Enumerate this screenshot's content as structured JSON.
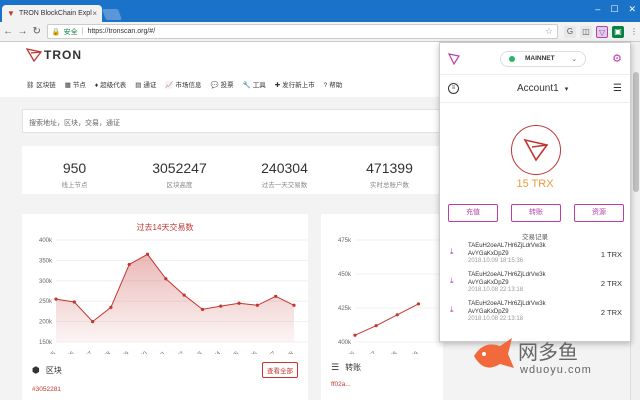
{
  "browser": {
    "tab_title": "TRON BlockChain Expl",
    "tab_close": "×",
    "secure_label": "安全",
    "url": "https://tronscan.org/#/",
    "win_min": "–",
    "win_max": "☐",
    "win_close": "✕"
  },
  "site": {
    "logo_text": "TRON",
    "nav": [
      {
        "icon": "⛓",
        "label": "区块链"
      },
      {
        "icon": "▦",
        "label": "节点"
      },
      {
        "icon": "♦",
        "label": "超级代表"
      },
      {
        "icon": "▤",
        "label": "通证"
      },
      {
        "icon": "📈",
        "label": "市场信息"
      },
      {
        "icon": "💬",
        "label": "投票"
      },
      {
        "icon": "🔧",
        "label": "工具"
      },
      {
        "icon": "✚",
        "label": "发行新上市"
      },
      {
        "icon": "?",
        "label": "帮助"
      }
    ],
    "search_placeholder": "搜索地址，区块，交易，通证",
    "stats": [
      {
        "value": "950",
        "label": "线上节点"
      },
      {
        "value": "3052247",
        "label": "区块高度"
      },
      {
        "value": "240304",
        "label": "过去一天交易数"
      },
      {
        "value": "471399",
        "label": "实时总账户数"
      }
    ],
    "panel_blocks": {
      "title": "区块",
      "view_all": "查看全部",
      "row": "#3052281"
    },
    "panel_transfers": {
      "title": "转账",
      "row": "ff02a..."
    }
  },
  "chart_data": [
    {
      "type": "area",
      "title": "过去14天交易数",
      "categories": [
        "9/25",
        "9/26",
        "9/27",
        "9/28",
        "9/29",
        "9/30",
        "10/1",
        "10/2",
        "10/3",
        "10/4",
        "10/5",
        "10/6",
        "10/7",
        "10/8"
      ],
      "values": [
        255000,
        248000,
        200000,
        235000,
        340000,
        365000,
        305000,
        265000,
        230000,
        238000,
        245000,
        240000,
        262000,
        240000
      ],
      "yticks": [
        "150k",
        "200k",
        "250k",
        "300k",
        "350k",
        "400k"
      ],
      "ylim": [
        150000,
        400000
      ],
      "color": "#c23631"
    },
    {
      "type": "line",
      "title": "",
      "categories": [
        "9/26",
        "9/27",
        "9/28",
        "9/29"
      ],
      "values": [
        405000,
        412000,
        420000,
        428000
      ],
      "yticks": [
        "400k",
        "425k",
        "450k",
        "475k"
      ],
      "ylim": [
        400000,
        475000
      ],
      "color": "#c23631"
    }
  ],
  "wallet": {
    "network": "MAINNET",
    "account": "Account1",
    "balance": "15 TRX",
    "actions": [
      "充值",
      "转账",
      "资源"
    ],
    "tx_title": "交易记录",
    "transactions": [
      {
        "addr1": "TAEuH2oeAL7Hr6ZjLdrVw3k",
        "addr2": "AvYGaKxDpZ9",
        "date": "2018.10.09 18:15:36",
        "amount": "1 TRX"
      },
      {
        "addr1": "TAEuH2oeAL7Hr6ZjLdrVw3k",
        "addr2": "AvYGaKxDpZ9",
        "date": "2018.10.08 22:13:18",
        "amount": "2 TRX"
      },
      {
        "addr1": "TAEuH2oeAL7Hr6ZjLdrVw3k",
        "addr2": "AvYGaKxDpZ9",
        "date": "2018.10.08 22:13:18",
        "amount": "2 TRX"
      }
    ]
  },
  "watermark": {
    "cn": "网多鱼",
    "en": "wduoyu.com"
  }
}
